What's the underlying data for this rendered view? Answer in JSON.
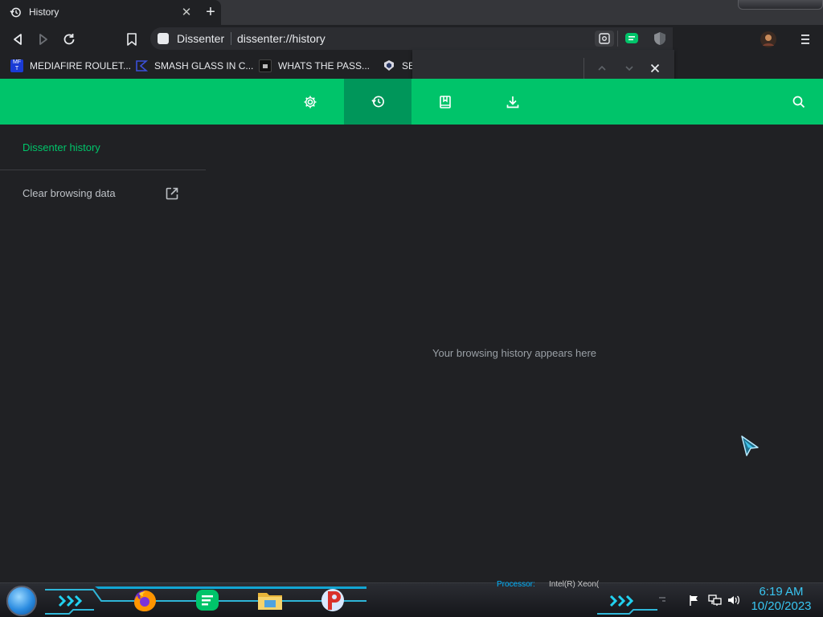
{
  "tab": {
    "title": "History",
    "icon": "history-icon",
    "close_glyph": "✕",
    "new_tab_glyph": "+"
  },
  "toolbar": {
    "site_name": "Dissenter",
    "url": "dissenter://history"
  },
  "bookmarks": [
    {
      "label": "MEDIAFIRE ROULET...",
      "icon": "mediafire-favicon",
      "color": "#1a3bd6"
    },
    {
      "label": "SMASH GLASS IN C...",
      "icon": "smash-favicon",
      "color": "#3b50d9"
    },
    {
      "label": "WHATS THE PASS...",
      "icon": "whats-favicon",
      "color": "#111111"
    },
    {
      "label": "SE",
      "icon": "se-favicon",
      "color": "#2b3a66"
    }
  ],
  "header": {
    "active_tab": "history",
    "color": "#00c46a",
    "active_color": "#00965a"
  },
  "sidebar": {
    "title": "Dissenter history",
    "clear_label": "Clear browsing data"
  },
  "main": {
    "empty_message": "Your browsing history appears here"
  },
  "taskbar": {
    "processor_label": "Processor:",
    "processor_value": "Intel(R) Xeon(",
    "clock_time": "6:19 AM",
    "clock_date": "10/20/2023",
    "apps": [
      "firefox-icon",
      "dissenter-icon",
      "file-explorer-icon",
      "app-p-icon"
    ]
  }
}
